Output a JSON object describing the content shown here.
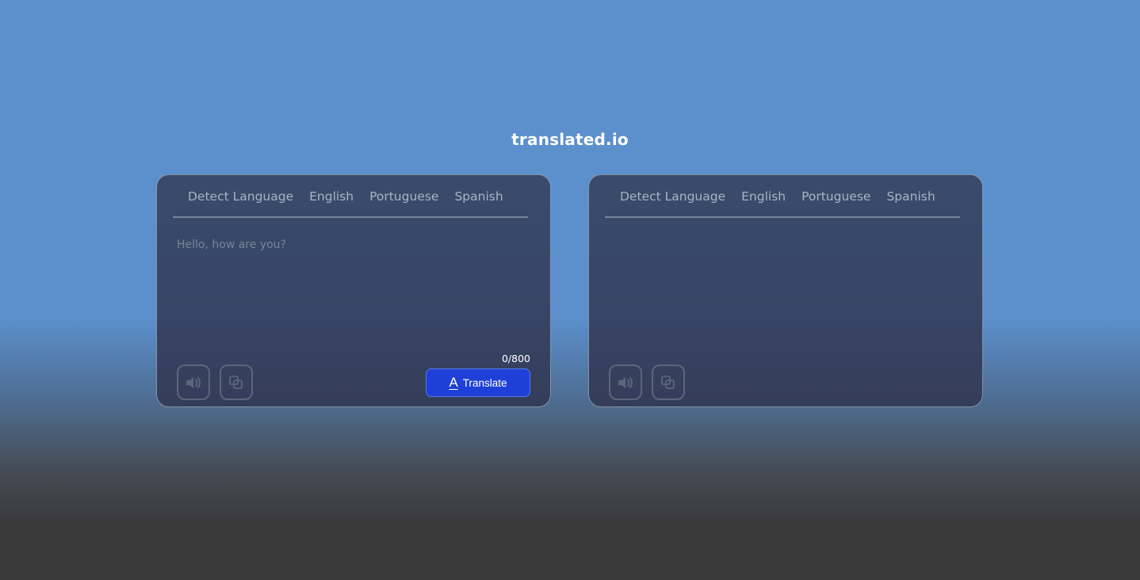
{
  "brand": {
    "title": "translated.io"
  },
  "source_panel": {
    "tabs": [
      {
        "label": "Detect Language"
      },
      {
        "label": "English"
      },
      {
        "label": "Portuguese"
      },
      {
        "label": "Spanish"
      }
    ],
    "input": {
      "value": "",
      "placeholder": "Hello, how are you?"
    },
    "counter": "0/800",
    "translate_button": {
      "icon": "A",
      "label": "Translate"
    },
    "icons": [
      "speaker-icon",
      "copy-icon"
    ]
  },
  "target_panel": {
    "tabs": [
      {
        "label": "Detect Language"
      },
      {
        "label": "English"
      },
      {
        "label": "Portuguese"
      },
      {
        "label": "Spanish"
      }
    ],
    "output": "",
    "icons": [
      "speaker-icon",
      "copy-icon"
    ]
  },
  "colors": {
    "background_top": "#5b90cc",
    "background_bottom": "#3a3a3b",
    "accent": "#1e40d8",
    "tab_text": "#aab3c4"
  }
}
